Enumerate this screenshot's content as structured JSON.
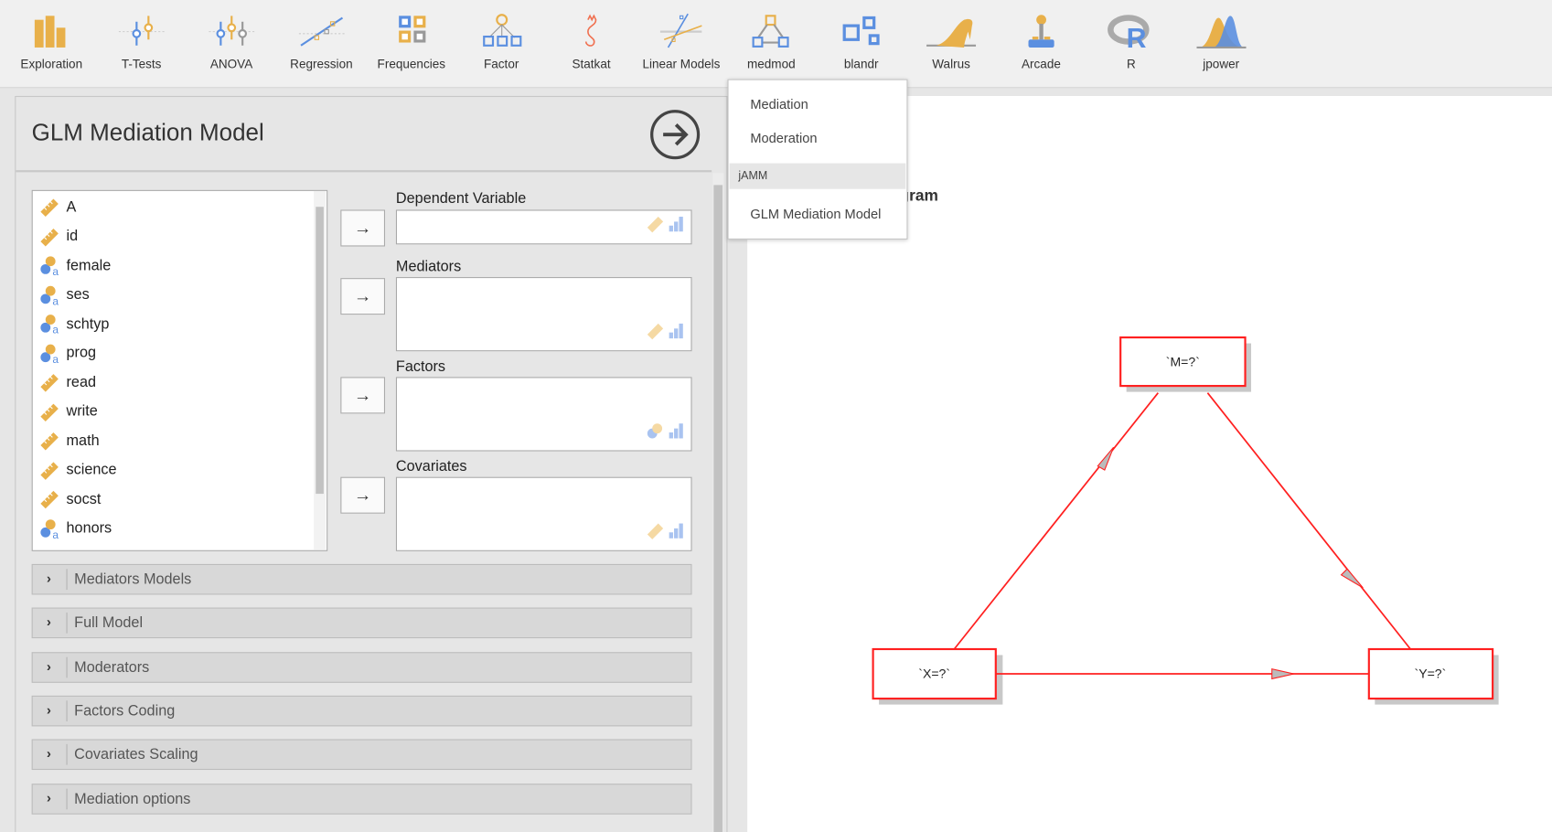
{
  "toolbar": [
    {
      "label": "Exploration",
      "icon": "exploration-icon"
    },
    {
      "label": "T-Tests",
      "icon": "ttests-icon"
    },
    {
      "label": "ANOVA",
      "icon": "anova-icon"
    },
    {
      "label": "Regression",
      "icon": "regression-icon"
    },
    {
      "label": "Frequencies",
      "icon": "frequencies-icon"
    },
    {
      "label": "Factor",
      "icon": "factor-icon"
    },
    {
      "label": "Statkat",
      "icon": "statkat-icon"
    },
    {
      "label": "Linear Models",
      "icon": "linear-models-icon"
    },
    {
      "label": "medmod",
      "icon": "medmod-icon"
    },
    {
      "label": "blandr",
      "icon": "blandr-icon"
    },
    {
      "label": "Walrus",
      "icon": "walrus-icon"
    },
    {
      "label": "Arcade",
      "icon": "arcade-icon"
    },
    {
      "label": "R",
      "icon": "r-icon"
    },
    {
      "label": "jpower",
      "icon": "jpower-icon"
    }
  ],
  "panel": {
    "title": "GLM Mediation Model",
    "variables": [
      {
        "name": "A",
        "type": "continuous"
      },
      {
        "name": "id",
        "type": "continuous"
      },
      {
        "name": "female",
        "type": "nominal"
      },
      {
        "name": "ses",
        "type": "nominal"
      },
      {
        "name": "schtyp",
        "type": "nominal"
      },
      {
        "name": "prog",
        "type": "nominal"
      },
      {
        "name": "read",
        "type": "continuous"
      },
      {
        "name": "write",
        "type": "continuous"
      },
      {
        "name": "math",
        "type": "continuous"
      },
      {
        "name": "science",
        "type": "continuous"
      },
      {
        "name": "socst",
        "type": "continuous"
      },
      {
        "name": "honors",
        "type": "nominal"
      }
    ],
    "targets": {
      "dependent": "Dependent Variable",
      "mediators": "Mediators",
      "factors": "Factors",
      "covariates": "Covariates"
    },
    "arrow": "→",
    "sections": [
      "Mediators Models",
      "Full Model",
      "Moderators",
      "Factors Coding",
      "Covariates Scaling",
      "Mediation options"
    ]
  },
  "results": {
    "title": "Model diagram",
    "nodes": {
      "m": "`M=?`",
      "x": "`X=?`",
      "y": "`Y=?`"
    }
  },
  "menu": {
    "items": [
      "Mediation",
      "Moderation"
    ],
    "header": "jAMM",
    "sub_items": [
      "GLM Mediation Model"
    ]
  },
  "colors": {
    "orange": "#e8b04a",
    "blue": "#5b8fe0",
    "red": "#ff2020"
  }
}
